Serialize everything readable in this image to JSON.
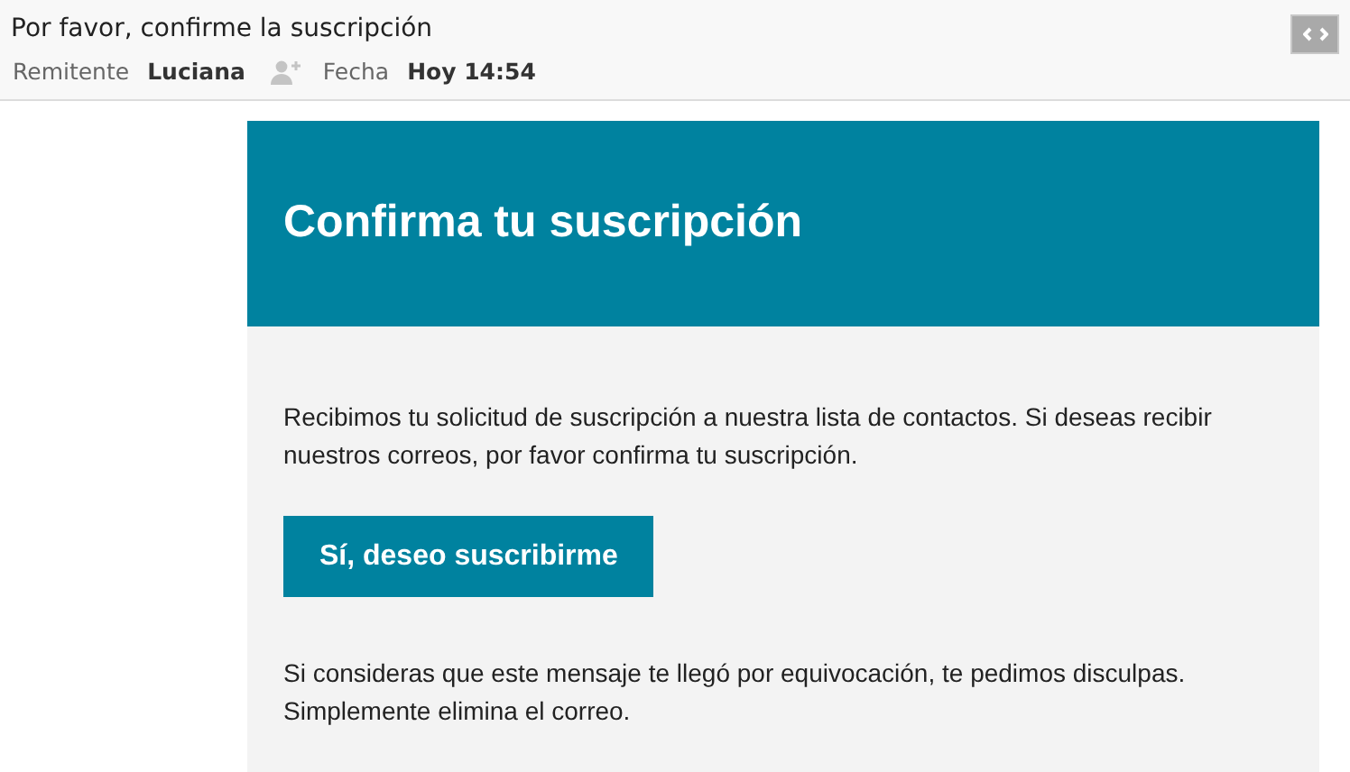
{
  "subject": "Por favor, confirme la suscripción",
  "meta": [
    {
      "label": "Remitente",
      "value": "Luciana",
      "kind": "sender"
    },
    {
      "label": "Fecha",
      "value": "Hoy 14:54",
      "kind": "date"
    }
  ],
  "email": {
    "heading": "Confirma tu suscripción",
    "intro": "Recibimos tu solicitud de suscripción a nuestra lista de contactos. Si deseas recibir nuestros correos, por favor confirma tu suscripción.",
    "button": "Sí, deseo suscribirme",
    "footer": "Si consideras que este mensaje te llegó por equivocación, te pedimos disculpas. Simplemente elimina el correo."
  }
}
